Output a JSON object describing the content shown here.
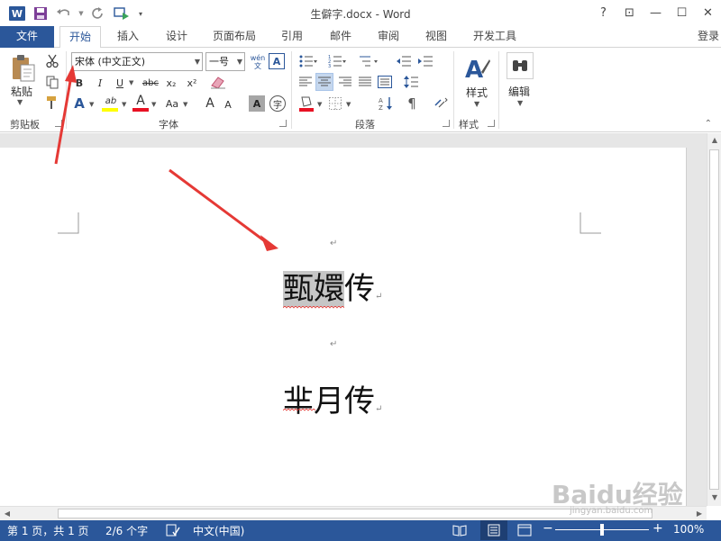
{
  "titlebar": {
    "title": "生僻字.docx - Word",
    "help": "?",
    "ribbon_display": "⊡",
    "minimize": "—",
    "maximize": "☐",
    "close": "✕"
  },
  "tabs": {
    "file": "文件",
    "items": [
      "开始",
      "插入",
      "设计",
      "页面布局",
      "引用",
      "邮件",
      "审阅",
      "视图",
      "开发工具"
    ],
    "active": "开始",
    "login": "登录"
  },
  "ribbon": {
    "clipboard": {
      "label": "剪贴板",
      "paste": "粘贴"
    },
    "font": {
      "label": "字体",
      "font_name": "宋体 (中文正文)",
      "font_size": "一号",
      "phonetic": "wén文",
      "char_border": "A",
      "bold": "B",
      "italic": "I",
      "underline": "U",
      "strikethrough": "abc",
      "subscript": "x₂",
      "superscript": "x²",
      "text_effects": "A",
      "highlight": "ab",
      "font_color": "A",
      "change_case": "Aa",
      "grow": "A",
      "shrink": "A",
      "char_shading": "A",
      "enclose": "字"
    },
    "paragraph": {
      "label": "段落"
    },
    "styles": {
      "label": "样式",
      "button": "样式"
    },
    "editing": {
      "button": "编辑"
    }
  },
  "document": {
    "lines": [
      {
        "highlighted": "甄嬛",
        "rest": "传"
      },
      {
        "highlighted": "",
        "rest": "芈月传"
      }
    ],
    "para_mark": "↵"
  },
  "statusbar": {
    "page": "第 1 页，共 1 页",
    "words": "2/6 个字",
    "language": "中文(中国)",
    "zoom_out": "−",
    "zoom_in": "+",
    "zoom": "100%"
  },
  "watermark": {
    "brand": "Baidu经验",
    "url": "jingyan.baidu.com"
  },
  "colors": {
    "accent": "#2b579a",
    "arrow": "#e53935",
    "highlight_bar": "#ffff00",
    "font_color_bar": "#e81123",
    "selection": "#c6c6c6"
  }
}
